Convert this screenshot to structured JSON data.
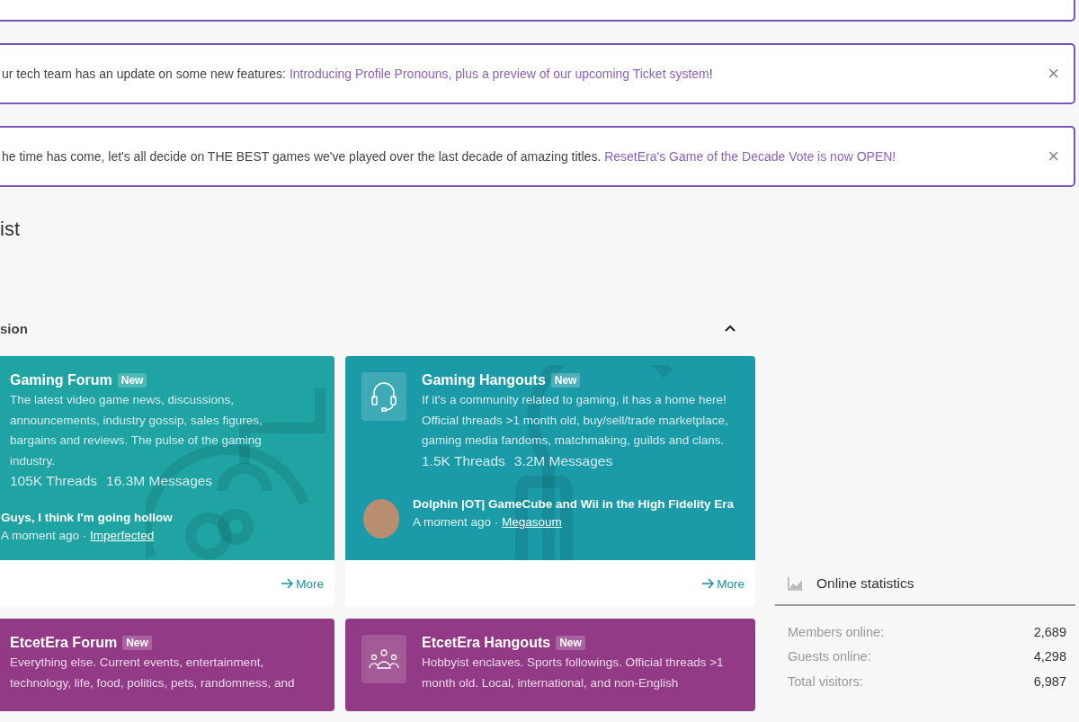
{
  "notices": [
    {
      "kind": "cut"
    },
    {
      "kind": "full",
      "text": "ur tech team has an update on some new features:",
      "link": "Introducing Profile Pronouns, plus a preview of our upcoming Ticket system",
      "suffix": "!",
      "close": "×"
    },
    {
      "kind": "full",
      "text": "he time has come, let's all decide on THE BEST games we've played over the last decade of amazing titles.",
      "link": "ResetEra's Game of the Decade Vote is now OPEN!",
      "close": "×"
    }
  ],
  "page_title": "ist",
  "section": {
    "title": "sion",
    "expanded": true,
    "nodes": [
      {
        "kind": "forum",
        "title": "Gaming Forum",
        "badge": "New",
        "color": "#1fa3a3",
        "description": "The latest video game news, discussions, announcements, industry gossip, sales figures, bargains and reviews. The pulse of the gaming industry.",
        "threads": "105K Threads",
        "messages": "16.3M Messages",
        "latest": {
          "title": "Guys, I think I'm going hollow",
          "time": "A moment ago ·",
          "author": "Imperfected"
        },
        "more": "More"
      },
      {
        "kind": "hangout",
        "title": "Gaming Hangouts",
        "badge": "New",
        "color": "#1b9aa8",
        "description": "If it's a community related to gaming, it has a home here! Official threads >1 month old, buy/sell/trade marketplace, gaming media fandoms, matchmaking, guilds and clans.",
        "threads": "1.5K Threads",
        "messages": "3.2M Messages",
        "latest": {
          "title": "Dolphin |OT| GameCube and Wii in the High Fidelity Era",
          "time": "A moment ago ·",
          "author": "Megasoum"
        },
        "more": "More"
      },
      {
        "kind": "forum",
        "title": "EtcetEra Forum",
        "badge": "New",
        "color": "#933a86",
        "description": "Everything else. Current events, entertainment, technology, life, food, politics, pets, randomness, and"
      },
      {
        "kind": "hangout",
        "title": "EtcetEra Hangouts",
        "badge": "New",
        "color": "#933a86",
        "description": "Hobbyist enclaves. Sports followings. Official threads >1 month old. Local, international, and non-English"
      }
    ]
  },
  "online_statistics": {
    "title": "Online statistics",
    "rows": [
      {
        "label": "Members online:",
        "value": "2,689"
      },
      {
        "label": "Guests online:",
        "value": "4,298"
      },
      {
        "label": "Total visitors:",
        "value": "6,987"
      }
    ]
  }
}
